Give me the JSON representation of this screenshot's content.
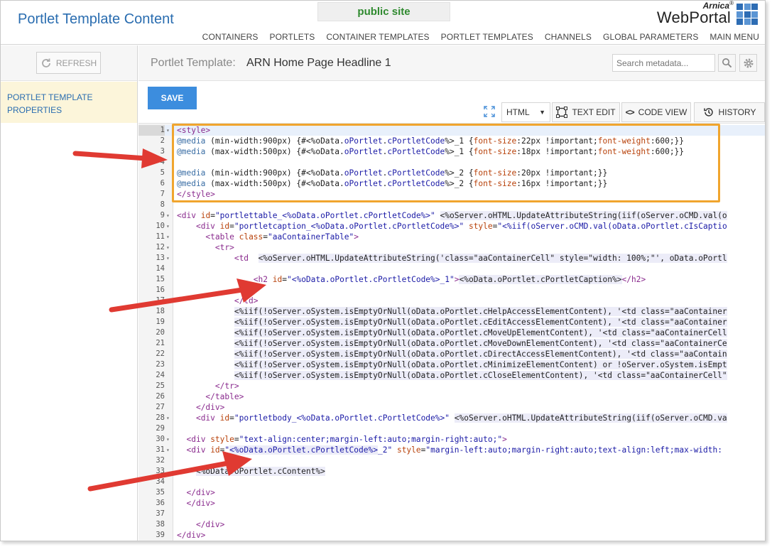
{
  "header": {
    "title": "Portlet Template Content",
    "site_badge": "public site",
    "brand_top": "Arnica",
    "brand_reg": "®",
    "brand_main": "WebPortal",
    "nav": [
      "CONTAINERS",
      "PORTLETS",
      "CONTAINER TEMPLATES",
      "PORTLET TEMPLATES",
      "CHANNELS",
      "GLOBAL PARAMETERS",
      "MAIN MENU"
    ]
  },
  "sidebar": {
    "refresh_label": "REFRESH",
    "item_line1": "PORTLET TEMPLATE",
    "item_line2": "PROPERTIES"
  },
  "main": {
    "label": "Portlet Template:",
    "name": "ARN Home Page Headline 1",
    "search_placeholder": "Search metadata...",
    "save_label": "SAVE",
    "mode_value": "HTML",
    "text_edit_label": "TEXT EDIT",
    "code_view_label": "CODE VIEW",
    "history_label": "HISTORY"
  },
  "editor": {
    "lines": [
      {
        "n": "1",
        "fold": true,
        "html": "<span class='tag'>&lt;style&gt;</span>"
      },
      {
        "n": "2",
        "html": "<span class='kw'>@media</span> (min-width:900px) {#&lt;%oData.<span class='str'>oPortlet</span>.<span class='str'>cPortletCode</span>%&gt;_1 {<span class='attr'>font-size</span>:22px !important;<span class='attr'>font-weight</span>:600;}}"
      },
      {
        "n": "3",
        "html": "<span class='kw'>@media</span> (max-width:500px) {#&lt;%oData.<span class='str'>oPortlet</span>.<span class='str'>cPortletCode</span>%&gt;_1 {<span class='attr'>font-size</span>:18px !important;<span class='attr'>font-weight</span>:600;}}"
      },
      {
        "n": "4",
        "html": ""
      },
      {
        "n": "5",
        "html": "<span class='kw'>@media</span> (min-width:900px) {#&lt;%oData.<span class='str'>oPortlet</span>.<span class='str'>cPortletCode</span>%&gt;_2 {<span class='attr'>font-size</span>:20px !important;}}"
      },
      {
        "n": "6",
        "html": "<span class='kw'>@media</span> (max-width:500px) {#&lt;%oData.<span class='str'>oPortlet</span>.<span class='str'>cPortletCode</span>%&gt;_2 {<span class='attr'>font-size</span>:16px !important;}}"
      },
      {
        "n": "7",
        "html": "<span class='tag'>&lt;/style&gt;</span>"
      },
      {
        "n": "8",
        "html": ""
      },
      {
        "n": "9",
        "fold": true,
        "html": "<span class='tag'>&lt;div</span> <span class='attr'>id</span>=<span class='str'>\"portlettable_&lt;%oData.oPortlet.cPortletCode%&gt;\"</span> <span class='hl'>&lt;%oServer.oHTML.UpdateAttributeString(iif(oServer.oCMD.val(o</span>"
      },
      {
        "n": "10",
        "fold": true,
        "html": "    <span class='tag'>&lt;div</span> <span class='attr'>id</span>=<span class='str'>\"portletcaption_&lt;%oData.oPortlet.cPortletCode%&gt;\"</span> <span class='attr'>style</span>=<span class='str'>\"&lt;%iif(oServer.oCMD.val(oData.oPortlet.cIsCaptio</span>"
      },
      {
        "n": "11",
        "fold": true,
        "html": "      <span class='tag'>&lt;table</span> <span class='attr'>class</span>=<span class='str'>\"aaContainerTable\"</span><span class='tag'>&gt;</span>"
      },
      {
        "n": "12",
        "fold": true,
        "html": "        <span class='tag'>&lt;tr&gt;</span>"
      },
      {
        "n": "13",
        "fold": true,
        "html": "            <span class='tag'>&lt;td</span>  <span class='hl'>&lt;%oServer.oHTML.UpdateAttributeString('class=\"aaContainerCell\" style=\"width: 100%;\"', oData.oPortl</span>"
      },
      {
        "n": "14",
        "html": ""
      },
      {
        "n": "15",
        "html": "                <span class='tag'>&lt;h2</span> <span class='attr'>id</span>=<span class='str'>\"&lt;%oData.oPortlet.cPortletCode%&gt;_1\"</span><span class='tag'>&gt;</span><span class='hl'>&lt;%oData.oPortlet.cPortletCaption%&gt;</span><span class='tag'>&lt;/h2&gt;</span>"
      },
      {
        "n": "16",
        "html": ""
      },
      {
        "n": "17",
        "html": "            <span class='tag'>&lt;/td&gt;</span>"
      },
      {
        "n": "18",
        "html": "            <span class='hl'>&lt;%iif(!oServer.oSystem.isEmptyOrNull(oData.oPortlet.cHelpAccessElementContent), '&lt;td class=\"aaContainer</span>"
      },
      {
        "n": "19",
        "html": "            <span class='hl'>&lt;%iif(!oServer.oSystem.isEmptyOrNull(oData.oPortlet.cEditAccessElementContent), '&lt;td class=\"aaContainer</span>"
      },
      {
        "n": "20",
        "html": "            <span class='hl'>&lt;%iif(!oServer.oSystem.isEmptyOrNull(oData.oPortlet.cMoveUpElementContent), '&lt;td class=\"aaContainerCell</span>"
      },
      {
        "n": "21",
        "html": "            <span class='hl'>&lt;%iif(!oServer.oSystem.isEmptyOrNull(oData.oPortlet.cMoveDownElementContent), '&lt;td class=\"aaContainerCe</span>"
      },
      {
        "n": "22",
        "html": "            <span class='hl'>&lt;%iif(!oServer.oSystem.isEmptyOrNull(oData.oPortlet.cDirectAccessElementContent), '&lt;td class=\"aaContain</span>"
      },
      {
        "n": "23",
        "html": "            <span class='hl'>&lt;%iif(!oServer.oSystem.isEmptyOrNull(oData.oPortlet.cMinimizeElementContent) or !oServer.oSystem.isEmpt</span>"
      },
      {
        "n": "24",
        "html": "            <span class='hl'>&lt;%iif(!oServer.oSystem.isEmptyOrNull(oData.oPortlet.cCloseElementContent), '&lt;td class=\"aaContainerCell\"</span>"
      },
      {
        "n": "25",
        "html": "        <span class='tag'>&lt;/tr&gt;</span>"
      },
      {
        "n": "26",
        "html": "      <span class='tag'>&lt;/table&gt;</span>"
      },
      {
        "n": "27",
        "html": "    <span class='tag'>&lt;/div&gt;</span>"
      },
      {
        "n": "28",
        "fold": true,
        "html": "    <span class='tag'>&lt;div</span> <span class='attr'>id</span>=<span class='str'>\"portletbody_&lt;%oData.oPortlet.cPortletCode%&gt;\"</span> <span class='hl'>&lt;%oServer.oHTML.UpdateAttributeString(iif(oServer.oCMD.va</span>"
      },
      {
        "n": "29",
        "html": ""
      },
      {
        "n": "30",
        "fold": true,
        "html": "  <span class='tag'>&lt;div</span> <span class='attr'>style</span>=<span class='str'>\"text-align:center;margin-left:auto;margin-right:auto;\"</span><span class='tag'>&gt;</span>"
      },
      {
        "n": "31",
        "fold": true,
        "html": "  <span class='tag'>&lt;div</span> <span class='attr'>id</span>=<span class='str'>\"<span class='hl'>&lt;%oData.oPortlet.cPortletCode%&gt;</span>_2\"</span> <span class='attr'>style</span>=<span class='str'>\"margin-left:auto;margin-right:auto;text-align:left;max-width:</span>"
      },
      {
        "n": "32",
        "html": ""
      },
      {
        "n": "33",
        "html": "    <span class='hl'>&lt;%oData.oPortlet.cContent%&gt;</span>"
      },
      {
        "n": "34",
        "html": ""
      },
      {
        "n": "35",
        "html": "  <span class='tag'>&lt;/div&gt;</span>"
      },
      {
        "n": "36",
        "html": "  <span class='tag'>&lt;/div&gt;</span>"
      },
      {
        "n": "37",
        "html": ""
      },
      {
        "n": "38",
        "html": "    <span class='tag'>&lt;/div&gt;</span>"
      },
      {
        "n": "39",
        "html": "<span class='tag'>&lt;/div&gt;</span>"
      }
    ]
  },
  "colors": {
    "accent": "#2a6db0",
    "save": "#3c8dde",
    "highlight_box": "#f0a52e",
    "arrow": "#e03a32",
    "site_badge_text": "#2f8a2f"
  }
}
